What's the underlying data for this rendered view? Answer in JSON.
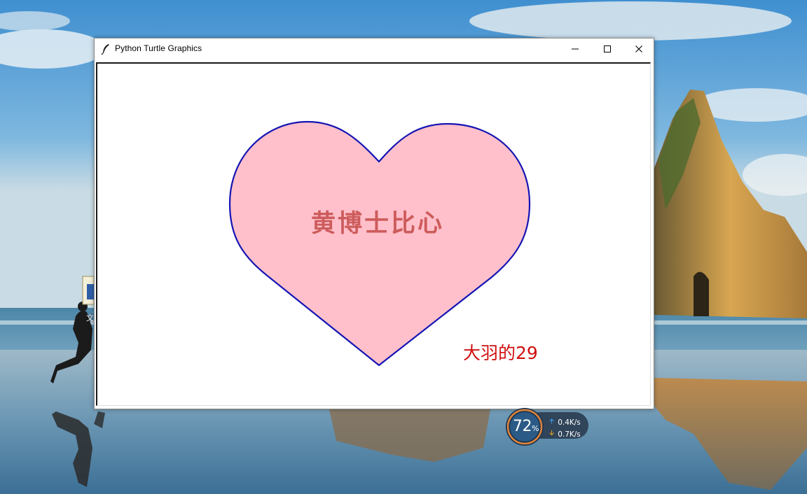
{
  "window": {
    "title": "Python Turtle Graphics",
    "icon": "feather-icon",
    "controls": [
      "minimize-icon",
      "maximize-icon",
      "close-icon"
    ]
  },
  "canvas": {
    "heart_fill_color": "#ffc0cb",
    "heart_outline_color": "#1414b4",
    "heart_text": "黄博士比心",
    "heart_text_color": "#cd5c5c",
    "signature_text": "大羽的29",
    "signature_color": "#d01010"
  },
  "desktop": {
    "icon_label": "文"
  },
  "net_widget": {
    "cpu_value": "72",
    "cpu_unit": "%",
    "upload_speed": "0.4K/s",
    "download_speed": "0.7K/s",
    "upload_icon": "arrow-up-icon",
    "download_icon": "arrow-down-icon"
  }
}
